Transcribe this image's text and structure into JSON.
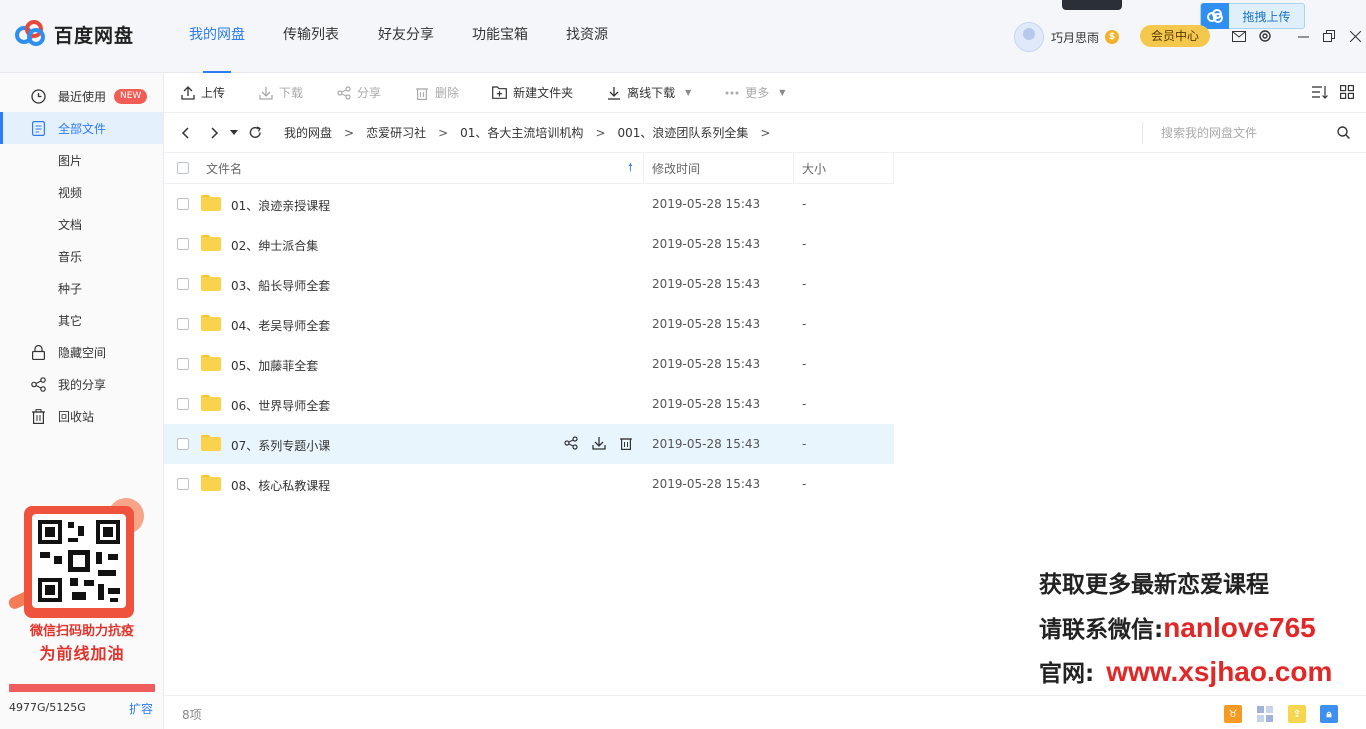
{
  "app": {
    "logo_text": "百度网盘",
    "nav_tabs": [
      "我的网盘",
      "传输列表",
      "好友分享",
      "功能宝箱",
      "找资源"
    ],
    "active_tab": "我的网盘",
    "username": "巧月思雨",
    "vip_coin": "$",
    "member_center": "会员中心",
    "drag_upload": "拖拽上传",
    "accent_color": "#2e7cf6"
  },
  "sidebar": {
    "items": [
      {
        "label": "最近使用",
        "icon": "clock-icon",
        "badge": "NEW"
      },
      {
        "label": "全部文件",
        "icon": "file-icon",
        "active": true
      },
      {
        "label": "图片"
      },
      {
        "label": "视频"
      },
      {
        "label": "文档"
      },
      {
        "label": "音乐"
      },
      {
        "label": "种子"
      },
      {
        "label": "其它"
      },
      {
        "label": "隐藏空间",
        "icon": "lock-icon"
      },
      {
        "label": "我的分享",
        "icon": "share-icon"
      },
      {
        "label": "回收站",
        "icon": "trash-icon"
      }
    ],
    "promo_line1": "微信扫码助力抗疫",
    "promo_line2": "为前线加油",
    "quota": "4977G/5125G",
    "quota_fraction": 0.971,
    "expand": "扩容"
  },
  "toolbar": {
    "upload": "上传",
    "download": "下载",
    "share": "分享",
    "delete": "删除",
    "new_folder": "新建文件夹",
    "offline_download": "离线下载",
    "more": "更多"
  },
  "breadcrumb": {
    "items": [
      "我的网盘",
      "恋爱研习社",
      "01、各大主流培训机构",
      "001、浪迹团队系列全集"
    ],
    "separator": ">",
    "search_placeholder": "搜索我的网盘文件"
  },
  "table": {
    "col_name": "文件名",
    "col_time": "修改时间",
    "col_size": "大小",
    "rows": [
      {
        "name": "01、浪迹亲授课程",
        "time": "2019-05-28 15:43",
        "size": "-"
      },
      {
        "name": "02、绅士派合集",
        "time": "2019-05-28 15:43",
        "size": "-"
      },
      {
        "name": "03、船长导师全套",
        "time": "2019-05-28 15:43",
        "size": "-"
      },
      {
        "name": "04、老吴导师全套",
        "time": "2019-05-28 15:43",
        "size": "-"
      },
      {
        "name": "05、加藤菲全套",
        "time": "2019-05-28 15:43",
        "size": "-"
      },
      {
        "name": "06、世界导师全套",
        "time": "2019-05-28 15:43",
        "size": "-"
      },
      {
        "name": "07、系列专题小课",
        "time": "2019-05-28 15:43",
        "size": "-",
        "hover": true
      },
      {
        "name": "08、核心私教课程",
        "time": "2019-05-28 15:43",
        "size": "-"
      }
    ]
  },
  "status": {
    "count": "8项"
  },
  "watermark": {
    "line1": "获取更多最新恋爱课程",
    "line2_prefix": "请联系微信:",
    "line2_value": "nanlove765",
    "line3_prefix": "官网:",
    "line3_value": "www.xsjhao.com"
  }
}
